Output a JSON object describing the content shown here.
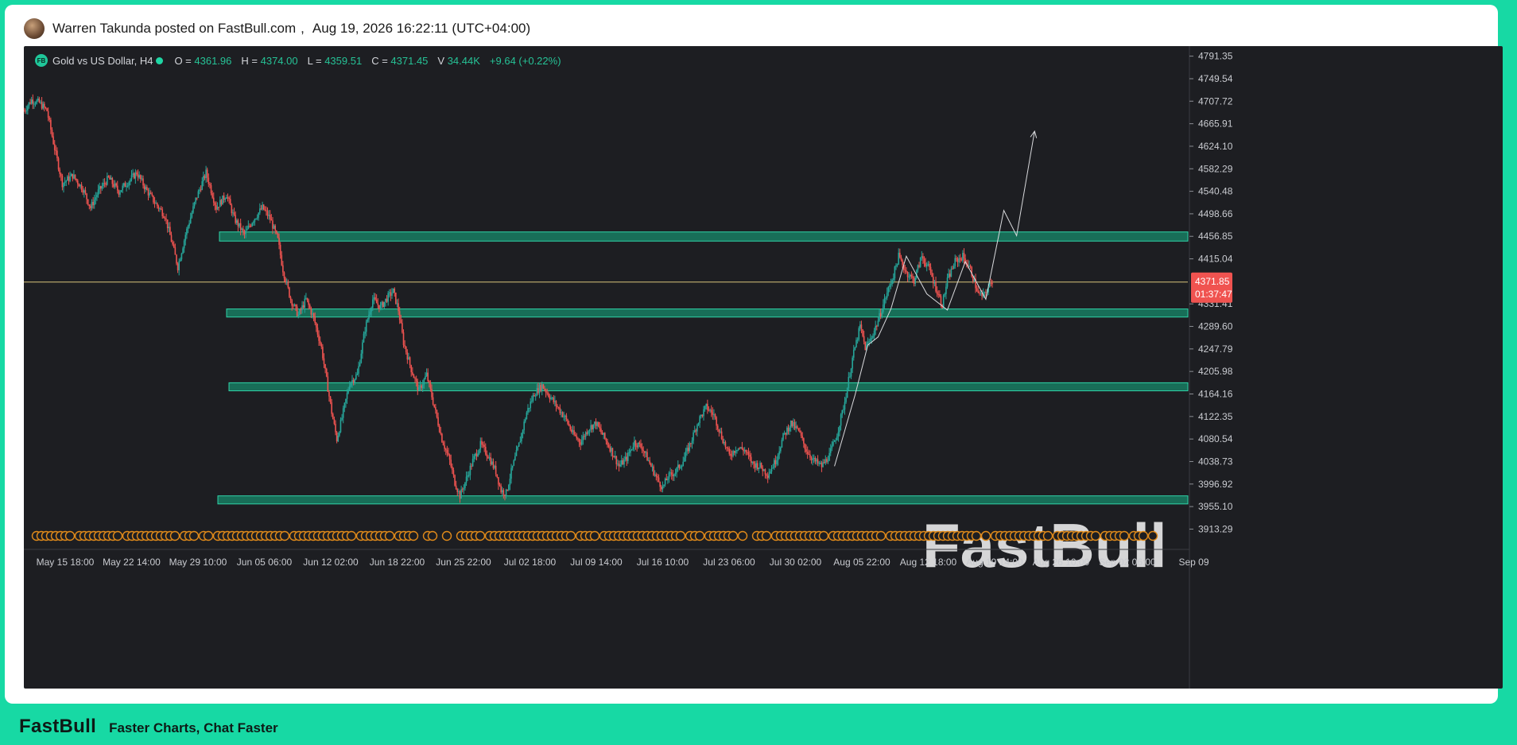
{
  "post": {
    "author_line": "Warren Takunda posted on FastBull.com",
    "separator": ",",
    "timestamp": "Aug 19, 2026 16:22:11 (UTC+04:00)"
  },
  "legend": {
    "symbol": "Gold vs US Dollar, H4",
    "logo": "FB",
    "open_label": "O =",
    "open": "4361.96",
    "high_label": "H =",
    "high": "4374.00",
    "low_label": "L =",
    "low": "4359.51",
    "close_label": "C =",
    "close": "4371.45",
    "volume_label": "V",
    "volume": "34.44K",
    "change": "+9.64 (+0.22%)"
  },
  "price_tag": {
    "price": "4371.85",
    "countdown": "01:37:47"
  },
  "watermark": "FastBull",
  "footer": {
    "brand": "FastBull",
    "tagline": "Faster Charts, Chat Faster"
  },
  "colors": {
    "up": "#26a69a",
    "down": "#ef5350",
    "zone_fill": "#178a6b",
    "zone_stroke": "#2fd3a8",
    "background": "#1d1e22",
    "accent": "#17d9a4"
  },
  "chart_data": {
    "type": "candlestick",
    "ylim": [
      3880,
      4810
    ],
    "y_ticks": [
      "4791.35",
      "4749.54",
      "4707.72",
      "4665.91",
      "4624.10",
      "4582.29",
      "4540.48",
      "4498.66",
      "4456.85",
      "4415.04",
      "4331.41",
      "4289.60",
      "4247.79",
      "4205.98",
      "4164.16",
      "4122.35",
      "4080.54",
      "4038.73",
      "3996.92",
      "3955.10",
      "3913.29"
    ],
    "x_ticks": [
      "May 15 18:00",
      "May 22 14:00",
      "May 29 10:00",
      "Jun 05 06:00",
      "Jun 12 02:00",
      "Jun 18 22:00",
      "Jun 25 22:00",
      "Jul 02 18:00",
      "Jul 09 14:00",
      "Jul 16 10:00",
      "Jul 23 06:00",
      "Jul 30 02:00",
      "Aug 05 22:00",
      "Aug 12 18:00",
      "Aug 19 14:00",
      "Aug 26 10:00",
      "Sep 02 06:00",
      "Sep 09"
    ],
    "x_range_index": [
      0,
      555
    ],
    "price_path": [
      [
        0,
        4690
      ],
      [
        6,
        4710
      ],
      [
        12,
        4705
      ],
      [
        18,
        4690
      ],
      [
        24,
        4620
      ],
      [
        30,
        4555
      ],
      [
        38,
        4570
      ],
      [
        46,
        4545
      ],
      [
        52,
        4510
      ],
      [
        58,
        4540
      ],
      [
        66,
        4565
      ],
      [
        74,
        4540
      ],
      [
        82,
        4560
      ],
      [
        88,
        4575
      ],
      [
        95,
        4545
      ],
      [
        102,
        4520
      ],
      [
        110,
        4495
      ],
      [
        116,
        4440
      ],
      [
        120,
        4400
      ],
      [
        126,
        4460
      ],
      [
        134,
        4525
      ],
      [
        142,
        4575
      ],
      [
        150,
        4510
      ],
      [
        158,
        4535
      ],
      [
        164,
        4490
      ],
      [
        172,
        4460
      ],
      [
        178,
        4485
      ],
      [
        186,
        4510
      ],
      [
        192,
        4490
      ],
      [
        198,
        4450
      ],
      [
        202,
        4395
      ],
      [
        208,
        4340
      ],
      [
        214,
        4310
      ],
      [
        220,
        4340
      ],
      [
        226,
        4305
      ],
      [
        232,
        4250
      ],
      [
        236,
        4190
      ],
      [
        240,
        4130
      ],
      [
        244,
        4080
      ],
      [
        248,
        4120
      ],
      [
        254,
        4185
      ],
      [
        260,
        4200
      ],
      [
        266,
        4285
      ],
      [
        272,
        4340
      ],
      [
        278,
        4325
      ],
      [
        284,
        4345
      ],
      [
        288,
        4355
      ],
      [
        292,
        4320
      ],
      [
        296,
        4260
      ],
      [
        302,
        4210
      ],
      [
        308,
        4170
      ],
      [
        314,
        4200
      ],
      [
        320,
        4140
      ],
      [
        326,
        4080
      ],
      [
        332,
        4040
      ],
      [
        336,
        4000
      ],
      [
        340,
        3975
      ],
      [
        344,
        4000
      ],
      [
        350,
        4040
      ],
      [
        356,
        4070
      ],
      [
        362,
        4050
      ],
      [
        368,
        4020
      ],
      [
        372,
        3985
      ],
      [
        376,
        3980
      ],
      [
        380,
        4020
      ],
      [
        386,
        4070
      ],
      [
        392,
        4130
      ],
      [
        398,
        4165
      ],
      [
        404,
        4180
      ],
      [
        410,
        4160
      ],
      [
        416,
        4140
      ],
      [
        422,
        4120
      ],
      [
        428,
        4090
      ],
      [
        434,
        4075
      ],
      [
        440,
        4100
      ],
      [
        446,
        4110
      ],
      [
        452,
        4085
      ],
      [
        458,
        4060
      ],
      [
        464,
        4030
      ],
      [
        470,
        4045
      ],
      [
        476,
        4075
      ],
      [
        482,
        4065
      ],
      [
        488,
        4035
      ],
      [
        494,
        4005
      ],
      [
        498,
        3990
      ],
      [
        502,
        4010
      ],
      [
        508,
        4020
      ],
      [
        514,
        4040
      ],
      [
        520,
        4075
      ],
      [
        526,
        4115
      ],
      [
        532,
        4140
      ],
      [
        538,
        4125
      ],
      [
        544,
        4085
      ],
      [
        550,
        4050
      ],
      [
        556,
        4065
      ],
      [
        562,
        4060
      ],
      [
        568,
        4035
      ],
      [
        574,
        4030
      ],
      [
        580,
        4015
      ],
      [
        586,
        4040
      ],
      [
        592,
        4085
      ],
      [
        598,
        4110
      ],
      [
        604,
        4095
      ],
      [
        610,
        4060
      ],
      [
        616,
        4040
      ],
      [
        622,
        4030
      ],
      [
        628,
        4050
      ],
      [
        634,
        4090
      ],
      [
        640,
        4150
      ],
      [
        646,
        4230
      ],
      [
        652,
        4290
      ],
      [
        656,
        4250
      ],
      [
        660,
        4265
      ],
      [
        666,
        4300
      ],
      [
        672,
        4345
      ],
      [
        678,
        4385
      ],
      [
        682,
        4420
      ],
      [
        688,
        4390
      ],
      [
        694,
        4375
      ],
      [
        700,
        4420
      ],
      [
        706,
        4395
      ],
      [
        712,
        4355
      ],
      [
        716,
        4330
      ],
      [
        720,
        4375
      ],
      [
        726,
        4410
      ],
      [
        732,
        4420
      ],
      [
        738,
        4395
      ],
      [
        744,
        4350
      ],
      [
        748,
        4345
      ],
      [
        752,
        4362
      ],
      [
        755,
        4372
      ]
    ],
    "zones": [
      {
        "top": 4465,
        "bottom": 4448
      },
      {
        "top": 4322,
        "bottom": 4307
      },
      {
        "top": 4185,
        "bottom": 4170
      },
      {
        "top": 3975,
        "bottom": 3960
      }
    ],
    "current_price": 4371.85,
    "projection": [
      [
        632,
        4030
      ],
      [
        648,
        4162
      ],
      [
        658,
        4255
      ],
      [
        666,
        4270
      ],
      [
        676,
        4322
      ],
      [
        688,
        4420
      ],
      [
        704,
        4350
      ],
      [
        720,
        4320
      ],
      [
        734,
        4410
      ],
      [
        750,
        4340
      ],
      [
        764,
        4505
      ],
      [
        774,
        4458
      ],
      [
        788,
        4652
      ]
    ]
  }
}
